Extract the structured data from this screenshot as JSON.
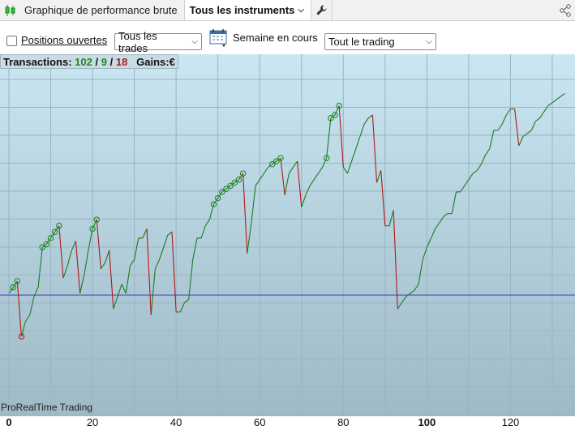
{
  "toolbar": {
    "title": "Graphique de performance brute",
    "instruments_dropdown": "Tous les instruments"
  },
  "filters": {
    "open_positions_label": "Positions ouvertes",
    "open_positions_checked": false,
    "trades_select": "Tous les trades",
    "period_label": "Semaine en cours",
    "trading_select": "Tout le trading"
  },
  "summary": {
    "label": "Transactions:",
    "total": "102",
    "sep1": "/",
    "wins": "9",
    "sep2": "/",
    "losses": "18",
    "gains_label": "Gains:",
    "gains_unit": "€"
  },
  "watermark": "ProRealTime Trading",
  "colors": {
    "background_top": "#c9e6f3",
    "background_bottom": "#9fb9c5",
    "grid": "#9ab4c1",
    "up_segment": "#1e7a1e",
    "down_segment": "#b01818",
    "baseline": "#2b2bc9",
    "marker": "#1e8a1e",
    "loss_marker": "#b01818"
  },
  "chart_data": {
    "type": "line",
    "x_ticks": [
      "0",
      "20",
      "40",
      "60",
      "80",
      "100",
      "120"
    ],
    "x_ticks_bold": [
      "0",
      "100"
    ],
    "xlim": [
      0,
      136
    ],
    "ylim": [
      0,
      100
    ],
    "baseline_y": 26.5,
    "points": [
      [
        0,
        27
      ],
      [
        1,
        29
      ],
      [
        2,
        31
      ],
      [
        3,
        13
      ],
      [
        4,
        18
      ],
      [
        5,
        20
      ],
      [
        6,
        26
      ],
      [
        7,
        29
      ],
      [
        8,
        42
      ],
      [
        9,
        43
      ],
      [
        10,
        45
      ],
      [
        11,
        47
      ],
      [
        12,
        49
      ],
      [
        13,
        32
      ],
      [
        14,
        36
      ],
      [
        15,
        41
      ],
      [
        16,
        44
      ],
      [
        17,
        27
      ],
      [
        18,
        33
      ],
      [
        19,
        41
      ],
      [
        20,
        48
      ],
      [
        21,
        51
      ],
      [
        22,
        35
      ],
      [
        23,
        37
      ],
      [
        24,
        41
      ],
      [
        25,
        22
      ],
      [
        26,
        26
      ],
      [
        27,
        30
      ],
      [
        28,
        27
      ],
      [
        29,
        36
      ],
      [
        30,
        38
      ],
      [
        31,
        45
      ],
      [
        32,
        45
      ],
      [
        33,
        48
      ],
      [
        34,
        20
      ],
      [
        35,
        35
      ],
      [
        36,
        38
      ],
      [
        37,
        42
      ],
      [
        38,
        46
      ],
      [
        39,
        47
      ],
      [
        40,
        21
      ],
      [
        41,
        21
      ],
      [
        42,
        24
      ],
      [
        43,
        25
      ],
      [
        44,
        38
      ],
      [
        45,
        45
      ],
      [
        46,
        45
      ],
      [
        47,
        49
      ],
      [
        48,
        51
      ],
      [
        49,
        56
      ],
      [
        50,
        58
      ],
      [
        51,
        60
      ],
      [
        52,
        61
      ],
      [
        53,
        62
      ],
      [
        54,
        63
      ],
      [
        55,
        64
      ],
      [
        56,
        66
      ],
      [
        57,
        40
      ],
      [
        58,
        50
      ],
      [
        59,
        62
      ],
      [
        60,
        64
      ],
      [
        61,
        66
      ],
      [
        62,
        68
      ],
      [
        63,
        69
      ],
      [
        64,
        70
      ],
      [
        65,
        71
      ],
      [
        66,
        59
      ],
      [
        67,
        66
      ],
      [
        68,
        68
      ],
      [
        69,
        70
      ],
      [
        70,
        55
      ],
      [
        71,
        59
      ],
      [
        72,
        62
      ],
      [
        73,
        64
      ],
      [
        74,
        66
      ],
      [
        75,
        68
      ],
      [
        76,
        71
      ],
      [
        77,
        84
      ],
      [
        78,
        85
      ],
      [
        79,
        88
      ],
      [
        80,
        68
      ],
      [
        81,
        66
      ],
      [
        82,
        70
      ],
      [
        83,
        74
      ],
      [
        84,
        78
      ],
      [
        85,
        82
      ],
      [
        86,
        84
      ],
      [
        87,
        85
      ],
      [
        88,
        63
      ],
      [
        89,
        67
      ],
      [
        90,
        49
      ],
      [
        91,
        49
      ],
      [
        92,
        54
      ],
      [
        93,
        22
      ],
      [
        94,
        24
      ],
      [
        95,
        26
      ],
      [
        96,
        27
      ],
      [
        97,
        28
      ],
      [
        98,
        30
      ],
      [
        99,
        38
      ],
      [
        100,
        42
      ],
      [
        101,
        45
      ],
      [
        102,
        48
      ],
      [
        103,
        50
      ],
      [
        104,
        52
      ],
      [
        105,
        53
      ],
      [
        106,
        53
      ],
      [
        107,
        60
      ],
      [
        108,
        60
      ],
      [
        109,
        62
      ],
      [
        110,
        64
      ],
      [
        111,
        66
      ],
      [
        112,
        67
      ],
      [
        113,
        69
      ],
      [
        114,
        72
      ],
      [
        115,
        74
      ],
      [
        116,
        80
      ],
      [
        117,
        80
      ],
      [
        118,
        82
      ],
      [
        119,
        85
      ],
      [
        120,
        87
      ],
      [
        121,
        87
      ],
      [
        122,
        75
      ],
      [
        123,
        78
      ],
      [
        124,
        79
      ],
      [
        125,
        80
      ],
      [
        126,
        83
      ],
      [
        127,
        84
      ],
      [
        128,
        86
      ],
      [
        129,
        88
      ],
      [
        130,
        89
      ],
      [
        131,
        90
      ],
      [
        132,
        91
      ],
      [
        133,
        92
      ]
    ],
    "markers": [
      1,
      2,
      3,
      8,
      9,
      10,
      11,
      12,
      20,
      21,
      49,
      50,
      51,
      52,
      53,
      54,
      55,
      56,
      63,
      64,
      65,
      76,
      77,
      78,
      79
    ],
    "loss_markers": [
      3
    ]
  }
}
